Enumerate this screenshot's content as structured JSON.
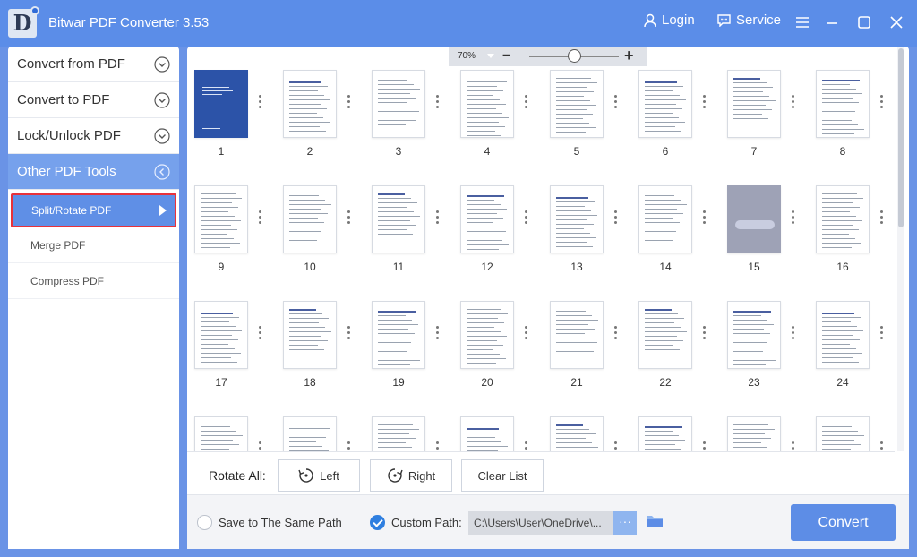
{
  "app": {
    "title": "Bitwar PDF Converter 3.53",
    "logo_letter": "D"
  },
  "titlebar": {
    "login_label": "Login",
    "service_label": "Service"
  },
  "sidebar": {
    "items": [
      {
        "label": "Convert from PDF"
      },
      {
        "label": "Convert to PDF"
      },
      {
        "label": "Lock/Unlock PDF"
      },
      {
        "label": "Other PDF Tools"
      }
    ],
    "sub_items": [
      {
        "label": "Split/Rotate PDF"
      },
      {
        "label": "Merge PDF"
      },
      {
        "label": "Compress PDF"
      }
    ]
  },
  "zoom": {
    "value": "70%",
    "minus": "−",
    "plus": "+",
    "level": 0.5
  },
  "pages": [
    "1",
    "2",
    "3",
    "4",
    "5",
    "6",
    "7",
    "8",
    "9",
    "10",
    "11",
    "12",
    "13",
    "14",
    "15",
    "16",
    "17",
    "18",
    "19",
    "20",
    "21",
    "22",
    "23",
    "24",
    "",
    "",
    "",
    "",
    "",
    "",
    "",
    ""
  ],
  "rotate": {
    "label": "Rotate All:",
    "left_label": "Left",
    "right_label": "Right",
    "clear_label": "Clear List"
  },
  "bottom": {
    "same_path_label": "Save to The Same Path",
    "custom_path_label": "Custom Path:",
    "path_value": "C:\\Users\\User\\OneDrive\\...",
    "more_label": "···",
    "convert_label": "Convert"
  },
  "colors": {
    "accent": "#5b8de8",
    "selected_border": "#e8313a"
  }
}
